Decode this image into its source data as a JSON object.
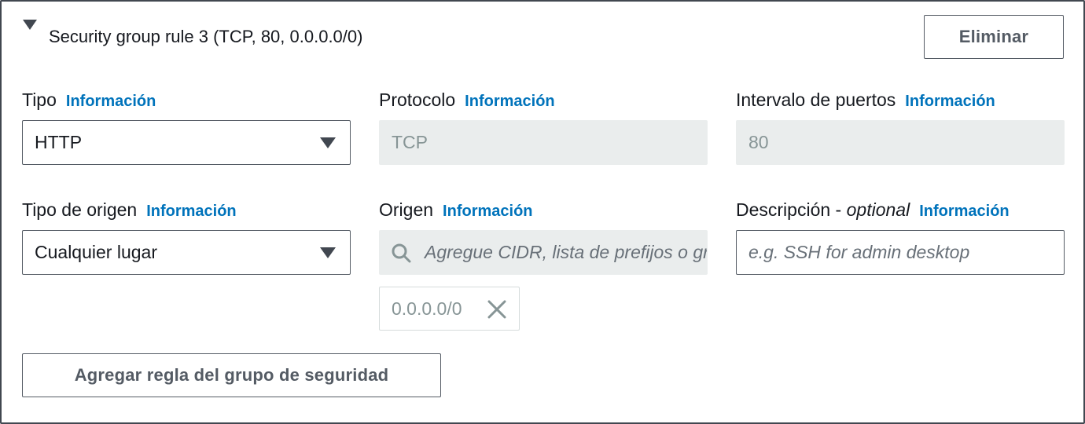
{
  "header": {
    "title": "Security group rule 3 (TCP, 80, 0.0.0.0/0)",
    "delete_label": "Eliminar"
  },
  "info_label": "Información",
  "fields": {
    "tipo": {
      "label": "Tipo",
      "value": "HTTP"
    },
    "protocolo": {
      "label": "Protocolo",
      "value": "TCP"
    },
    "intervalo": {
      "label": "Intervalo de puertos",
      "value": "80"
    },
    "tipo_origen": {
      "label": "Tipo de origen",
      "value": "Cualquier lugar"
    },
    "origen": {
      "label": "Origen",
      "placeholder": "Agregue CIDR, lista de prefijos o grupo de seguridad",
      "tokens": [
        "0.0.0.0/0"
      ]
    },
    "descripcion": {
      "label": "Descripción - ",
      "optional": "optional",
      "placeholder": "e.g. SSH for admin desktop"
    }
  },
  "footer": {
    "add_rule_label": "Agregar regla del grupo de seguridad"
  },
  "colors": {
    "border": "#545b64",
    "link": "#0073bb",
    "disabled_bg": "#eaeded",
    "text": "#16191f"
  },
  "icons": {
    "expand": "caret-down-icon",
    "dropdown": "caret-down-icon",
    "search": "search-icon",
    "remove": "close-icon"
  }
}
